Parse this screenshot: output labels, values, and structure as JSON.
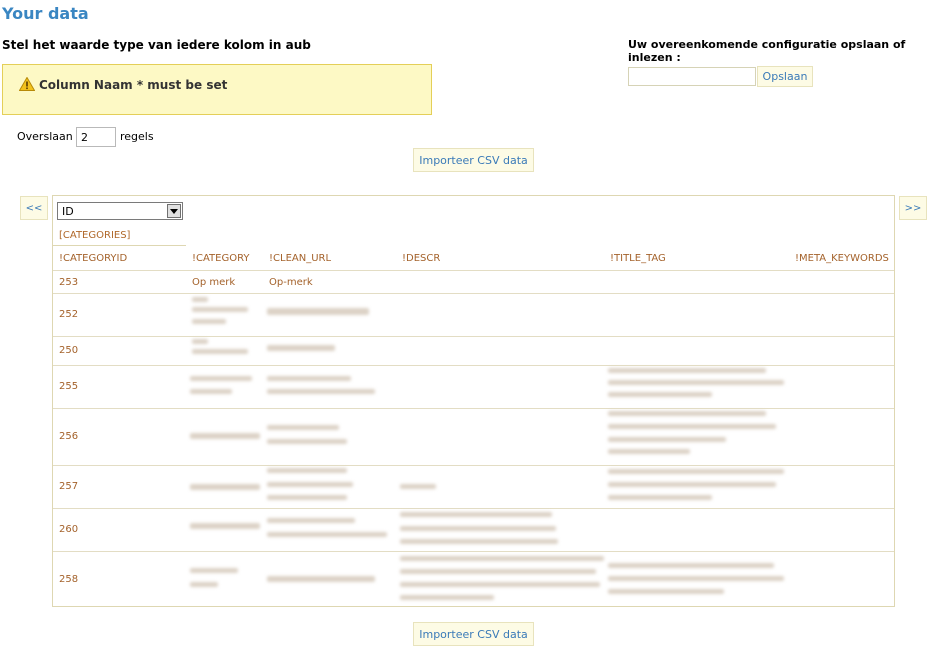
{
  "page": {
    "title": "Your data",
    "instruction": "Stel het waarde type van iedere kolom in aub",
    "warning_message": "Column Naam * must be set"
  },
  "config": {
    "label": "Uw overeenkomende configuratie opslaan of inlezen :",
    "input_value": "",
    "save_label": "Opslaan"
  },
  "skip": {
    "label": "Overslaan",
    "value": "2",
    "unit": "regels"
  },
  "import_label": "Importeer CSV data",
  "nav": {
    "prev_label": "<<",
    "next_label": ">>"
  },
  "grid": {
    "type_select_value": "ID",
    "table_name": "[CATEGORIES]",
    "columns": [
      "!CATEGORYID",
      "!CATEGORY",
      "!CLEAN_URL",
      "!DESCR",
      "!TITLE_TAG",
      "!META_KEYWORDS"
    ],
    "rows": [
      {
        "id": "253",
        "category": "Op merk",
        "clean_url": "Op-merk"
      },
      {
        "id": "252"
      },
      {
        "id": "250"
      },
      {
        "id": "255"
      },
      {
        "id": "256"
      },
      {
        "id": "257"
      },
      {
        "id": "260"
      },
      {
        "id": "258"
      }
    ]
  },
  "colors": {
    "title": "#3a86c2",
    "warning_bg": "#fdf9c5",
    "warning_border": "#e4cf58",
    "button_bg": "#fdfbe5",
    "button_text": "#3a7ab8",
    "cell_text": "#a4622b"
  },
  "icons": {
    "warning": "warning-triangle-icon",
    "dropdown": "chevron-down-icon"
  }
}
